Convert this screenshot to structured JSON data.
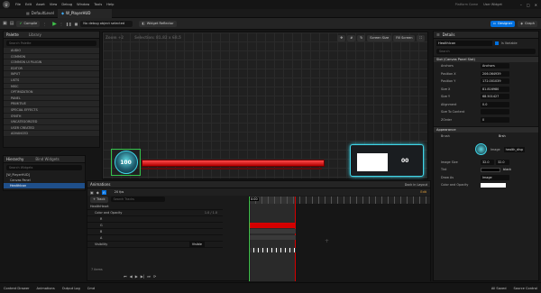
{
  "titlebar": {
    "menu": [
      "File",
      "Edit",
      "Asset",
      "View",
      "Debug",
      "Window",
      "Tools",
      "Help"
    ],
    "project": "Platform Game",
    "user": "User Widget"
  },
  "tabs": [
    {
      "label": "DefaultLevel",
      "active": false
    },
    {
      "label": "W_PlayerHUD",
      "active": true
    }
  ],
  "toolbar": {
    "compile": "Compile",
    "debug_select": "No debug object selected",
    "widget_reflector": "Widget Reflector",
    "designer": "Designer",
    "graph": "Graph"
  },
  "palette": {
    "tabs": [
      "Palette",
      "Library"
    ],
    "search_placeholder": "Search Palette",
    "categories": [
      "AUDIO",
      "COMMON",
      "COMMON UI PLUGIN",
      "EDITOR",
      "INPUT",
      "LISTS",
      "MISC",
      "OPTIMIZATION",
      "PANEL",
      "PRIMITIVE",
      "SPECIAL EFFECTS",
      "SYNTH",
      "UNCATEGORIZED",
      "USER CREATED",
      "ADVANCED"
    ]
  },
  "hierarchy": {
    "tabs": [
      "Hierarchy",
      "Bind Widgets"
    ],
    "search_placeholder": "Search Widgets",
    "items": [
      "[W_PlayerHUD]",
      "Canvas Panel",
      "HealthIcon"
    ]
  },
  "designer": {
    "zoom": "Zoom +2",
    "selection": "Selection: 81.82 x 68.5",
    "screen_size": "Screen Size",
    "fill_screen": "Fill Screen",
    "health_value": "100",
    "score_value": "00"
  },
  "details": {
    "title": "Details",
    "widget_name": "HealthIcon",
    "is_variable": "Is Variable",
    "search_placeholder": "Search",
    "slot_section": "Slot (Canvas Panel Slot)",
    "props": [
      {
        "k": "Anchors",
        "v": "Anchors"
      },
      {
        "k": "Position X",
        "v": "206.064939"
      },
      {
        "k": "Position Y",
        "v": "172.001039"
      },
      {
        "k": "Size X",
        "v": "81.816980"
      },
      {
        "k": "Size Y",
        "v": "68.501427"
      },
      {
        "k": "Alignment",
        "v": "0.0"
      },
      {
        "k": "Size To Content",
        "v": ""
      },
      {
        "k": "ZOrder",
        "v": "0"
      }
    ],
    "appearance": "Appearance",
    "brush": "Brush",
    "brush_value": "Brsh",
    "image_label": "Image",
    "image_value": "health_disp",
    "image_size_label": "Image Size",
    "image_size_x": "32.0",
    "image_size_y": "32.0",
    "tint_label": "Tint",
    "tint_value": "black",
    "draw_as_label": "Draw As",
    "draw_as_value": "Image",
    "color_opacity": "Color and Opacity"
  },
  "animations": {
    "tab": "Animations",
    "dock_label": "Dock in Layout",
    "add_track": "+ Track",
    "search_placeholder": "Search Tracks",
    "fps": "20 fps",
    "edit": "Edit",
    "tracks": [
      "HealthHeart",
      "Color and Opacity",
      "R",
      "G",
      "B",
      "A",
      "Visibility"
    ],
    "color_value": "1.0 / 1.0",
    "visibility_value": "Visible",
    "items_count": "7 items",
    "playhead": "0:00",
    "bar_color": "#d40000"
  },
  "statusbar": {
    "items": [
      "Content Drawer",
      "Animations",
      "Output Log",
      "Cmd"
    ],
    "right": [
      "All Saved",
      "Source Control"
    ]
  },
  "colors": {
    "accent": "#0070e0",
    "health_green": "#33c24a",
    "health_bar": "#c61414",
    "glow": "#3fd6e8"
  }
}
